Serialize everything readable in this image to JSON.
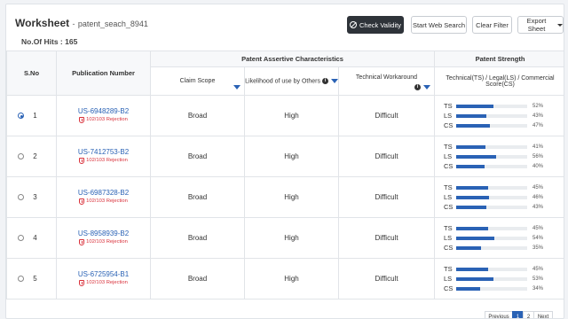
{
  "header": {
    "title": "Worksheet",
    "separator": "-",
    "file_name": "patent_seach_8941",
    "hits_label": "No.Of Hits :",
    "hits_count": "165"
  },
  "toolbar": {
    "check_validity": "Check Validity",
    "start_web_search": "Start Web Search",
    "clear_filter": "Clear Filter",
    "export_sheet": "Export Sheet"
  },
  "columns": {
    "sno": "S.No",
    "publication": "Publication Number",
    "assertive_group": "Patent Assertive Characteristics",
    "claim_scope": "Claim Scope",
    "likelihood": "Likelihood of use by Others",
    "workaround": "Technical Workaround",
    "strength_group": "Patent Strength",
    "strength_sub": "Technical(TS) / Legal(LS) / Commercial Score(CS)"
  },
  "rows": [
    {
      "sno": "1",
      "selected": true,
      "publication": "US-6948289-B2",
      "rejection": "102/103 Rejection",
      "claim": "Broad",
      "likelihood": "High",
      "workaround": "Difficult",
      "scores": [
        {
          "label": "TS",
          "pct": "52%",
          "value": 52
        },
        {
          "label": "LS",
          "pct": "43%",
          "value": 43
        },
        {
          "label": "CS",
          "pct": "47%",
          "value": 47
        }
      ]
    },
    {
      "sno": "2",
      "selected": false,
      "publication": "US-7412753-B2",
      "rejection": "102/103 Rejection",
      "claim": "Broad",
      "likelihood": "High",
      "workaround": "Difficult",
      "scores": [
        {
          "label": "TS",
          "pct": "41%",
          "value": 41
        },
        {
          "label": "LS",
          "pct": "56%",
          "value": 56
        },
        {
          "label": "CS",
          "pct": "40%",
          "value": 40
        }
      ]
    },
    {
      "sno": "3",
      "selected": false,
      "publication": "US-6987328-B2",
      "rejection": "102/103 Rejection",
      "claim": "Broad",
      "likelihood": "High",
      "workaround": "Difficult",
      "scores": [
        {
          "label": "TS",
          "pct": "45%",
          "value": 45
        },
        {
          "label": "LS",
          "pct": "46%",
          "value": 46
        },
        {
          "label": "CS",
          "pct": "43%",
          "value": 43
        }
      ]
    },
    {
      "sno": "4",
      "selected": false,
      "publication": "US-8958939-B2",
      "rejection": "102/103 Rejection",
      "claim": "Broad",
      "likelihood": "High",
      "workaround": "Difficult",
      "scores": [
        {
          "label": "TS",
          "pct": "45%",
          "value": 45
        },
        {
          "label": "LS",
          "pct": "54%",
          "value": 54
        },
        {
          "label": "CS",
          "pct": "35%",
          "value": 35
        }
      ]
    },
    {
      "sno": "5",
      "selected": false,
      "publication": "US-6725954-B1",
      "rejection": "102/103 Rejection",
      "claim": "Broad",
      "likelihood": "High",
      "workaround": "Difficult",
      "scores": [
        {
          "label": "TS",
          "pct": "45%",
          "value": 45
        },
        {
          "label": "LS",
          "pct": "53%",
          "value": 53
        },
        {
          "label": "CS",
          "pct": "34%",
          "value": 34
        }
      ]
    }
  ],
  "pagination": {
    "previous": "Previous",
    "pages": [
      "1",
      "2"
    ],
    "active_page": "1",
    "next": "Next"
  },
  "colors": {
    "accent": "#2a62b5",
    "rejection": "#d9303a",
    "dark_button": "#2e3339"
  },
  "icons": {
    "check_validity": "block-icon",
    "rejection": "shield-icon",
    "info": "info-icon",
    "sort": "sort-down-icon"
  }
}
